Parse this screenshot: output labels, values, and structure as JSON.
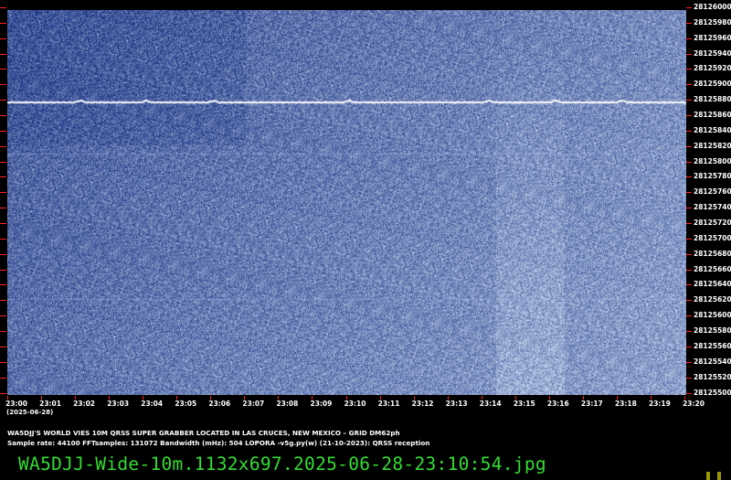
{
  "freq_labels": [
    "28126000",
    "28125980",
    "28125960",
    "28125940",
    "28125920",
    "28125900",
    "28125880",
    "28125860",
    "28125840",
    "28125820",
    "28125800",
    "28125780",
    "28125760",
    "28125740",
    "28125720",
    "28125700",
    "28125680",
    "28125660",
    "28125640",
    "28125620",
    "28125600",
    "28125580",
    "28125560",
    "28125540",
    "28125520",
    "28125500"
  ],
  "time_labels": [
    "23:00",
    "23:01",
    "23:02",
    "23:03",
    "23:04",
    "23:05",
    "23:06",
    "23:07",
    "23:08",
    "23:09",
    "23:10",
    "23:11",
    "23:12",
    "23:13",
    "23:14",
    "23:15",
    "23:16",
    "23:17",
    "23:18",
    "23:19",
    "23:20"
  ],
  "date_label": "(2025-06-28)",
  "info_line_1": "WA5DJJ'S WORLD VIES 10M QRSS SUPER GRABBER LOCATED IN LAS CRUCES, NEW MEXICO – GRID DM62ph",
  "info_line_2": "Sample rate: 44100    FFTsamples: 131072    Bandwidth (mHz): 504       LOPORA -v5g.py(w) (21-10-2023): QRSS reception",
  "filename": "WA5DJJ-Wide-10m.1132x697.2025-06-28-23:10:54.jpg",
  "colors": {
    "background": "#000000",
    "tick": "#ff2020",
    "filename": "#33dd33",
    "spectrum_dark": "#1e3c8c",
    "spectrum_light": "#c8dcff"
  },
  "chart_data": {
    "type": "heatmap",
    "x_axis": "time (UTC)",
    "x_range": [
      "23:00",
      "23:20"
    ],
    "y_range": [
      28125500,
      28126000
    ],
    "trace_frequency": 28125880
  }
}
